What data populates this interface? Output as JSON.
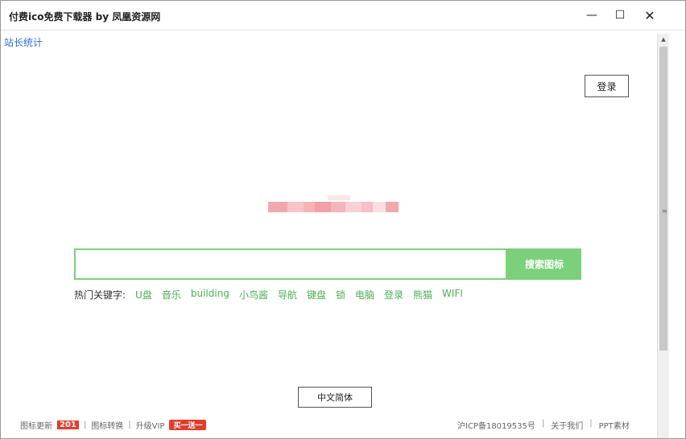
{
  "window": {
    "title": "付费ico免费下载器 by 凤凰资源网",
    "minimize": "—",
    "maximize": "☐",
    "close": "✕"
  },
  "top": {
    "stats_link": "站长统计",
    "login_label": "登录"
  },
  "search": {
    "value": "",
    "placeholder": "",
    "button_label": "搜索图标"
  },
  "hot": {
    "label": "热门关键字:",
    "keywords": [
      "U盘",
      "音乐",
      "building",
      "小鸟酱",
      "导航",
      "键盘",
      "锁",
      "电脑",
      "登录",
      "熊猫",
      "WIFI"
    ]
  },
  "lang_button": "中文简体",
  "footer": {
    "icon_update": "图标更新",
    "update_count": "201",
    "icon_convert": "图标转换",
    "upgrade_vip": "升级VIP",
    "promo": "买一送一",
    "icp": "沪ICP备18019535号",
    "about": "关于我们",
    "ppt": "PPT素材",
    "sep": "|"
  },
  "colors": {
    "accent_green": "#7bd17b",
    "keyword_green": "#4caf50",
    "link_blue": "#2b6fd6",
    "badge_red": "#e53b2c"
  },
  "icons": {
    "scroll_up": "triangle-up-icon",
    "scroll_grip": "grip-icon"
  }
}
